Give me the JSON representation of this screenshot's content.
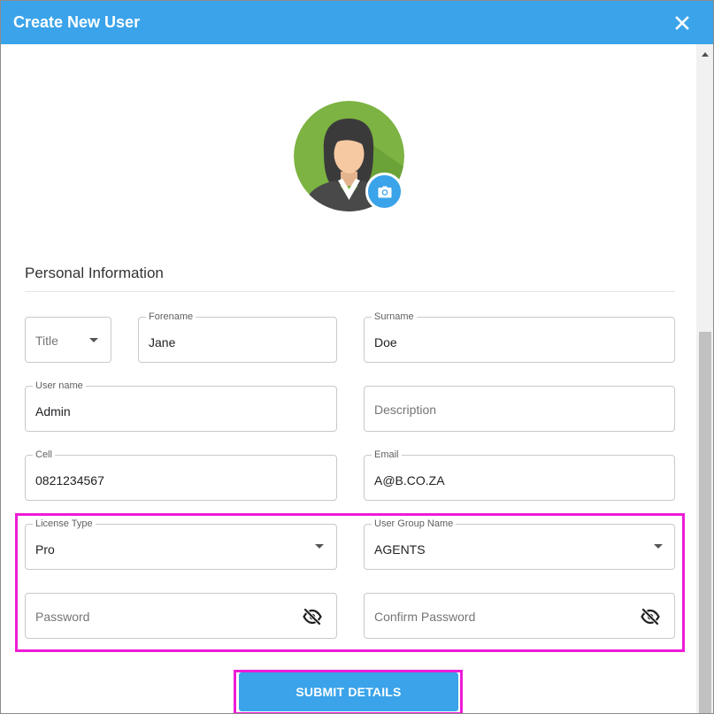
{
  "dialog": {
    "title": "Create New User",
    "close_icon": "close-icon",
    "accent_color": "#3aa3ea",
    "highlight_color": "#ee1bd6"
  },
  "avatar": {
    "icon": "user-avatar",
    "camera_icon": "camera-icon"
  },
  "section": {
    "title": "Personal Information"
  },
  "fields": {
    "title": {
      "placeholder": "Title",
      "icon": "chevron-down-icon"
    },
    "forename": {
      "label": "Forename",
      "value": "Jane"
    },
    "surname": {
      "label": "Surname",
      "value": "Doe"
    },
    "username": {
      "label": "User name",
      "value": "Admin"
    },
    "description": {
      "placeholder": "Description"
    },
    "cell": {
      "label": "Cell",
      "value": "0821234567"
    },
    "email": {
      "label": "Email",
      "value": "A@B.CO.ZA"
    },
    "license_type": {
      "label": "License Type",
      "value": "Pro",
      "icon": "chevron-down-icon"
    },
    "user_group": {
      "label": "User Group Name",
      "value": "AGENTS",
      "icon": "chevron-down-icon"
    },
    "password": {
      "placeholder": "Password",
      "icon": "eye-off-icon"
    },
    "confirm_password": {
      "placeholder": "Confirm Password",
      "icon": "eye-off-icon"
    }
  },
  "actions": {
    "submit_label": "SUBMIT DETAILS"
  }
}
